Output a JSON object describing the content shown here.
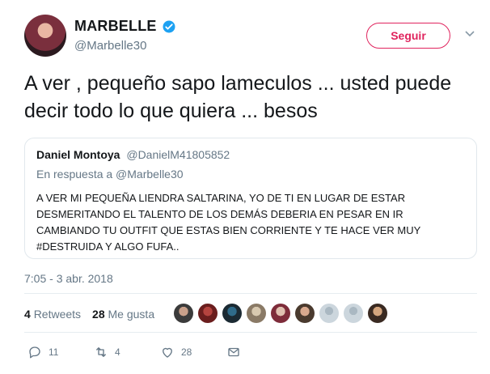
{
  "user": {
    "display_name": "MARBELLE",
    "handle": "@Marbelle30"
  },
  "follow_label": "Seguir",
  "tweet_text": "A ver , pequeño sapo lameculos ... usted puede decir todo lo que quiera ... besos",
  "quoted_tweet": {
    "name": "Daniel Montoya",
    "handle": "@DanielM41805852",
    "reply_to": "En respuesta a @Marbelle30",
    "text": "A VER MI PEQUEÑA LIENDRA SALTARINA, YO DE TI EN LUGAR DE ESTAR DESMERITANDO EL TALENTO DE LOS DEMÁS DEBERIA EN PESAR EN IR CAMBIANDO TU OUTFIT QUE ESTAS BIEN CORRIENTE Y TE HACE VER MUY #DESTRUIDA Y ALGO FUFA.."
  },
  "timestamp": "7:05 - 3 abr. 2018",
  "stats": {
    "retweets_count": "4",
    "retweets_label": "Retweets",
    "likes_count": "28",
    "likes_label": "Me gusta"
  },
  "actions": {
    "reply_count": "11",
    "retweet_count": "4",
    "like_count": "28"
  },
  "colors": {
    "accent": "#e0245e",
    "verified": "#1da1f2",
    "secondary_text": "#657786"
  },
  "icons": [
    "verified-badge-icon",
    "chevron-down-icon",
    "reply-icon",
    "retweet-icon",
    "like-icon",
    "direct-message-icon"
  ]
}
